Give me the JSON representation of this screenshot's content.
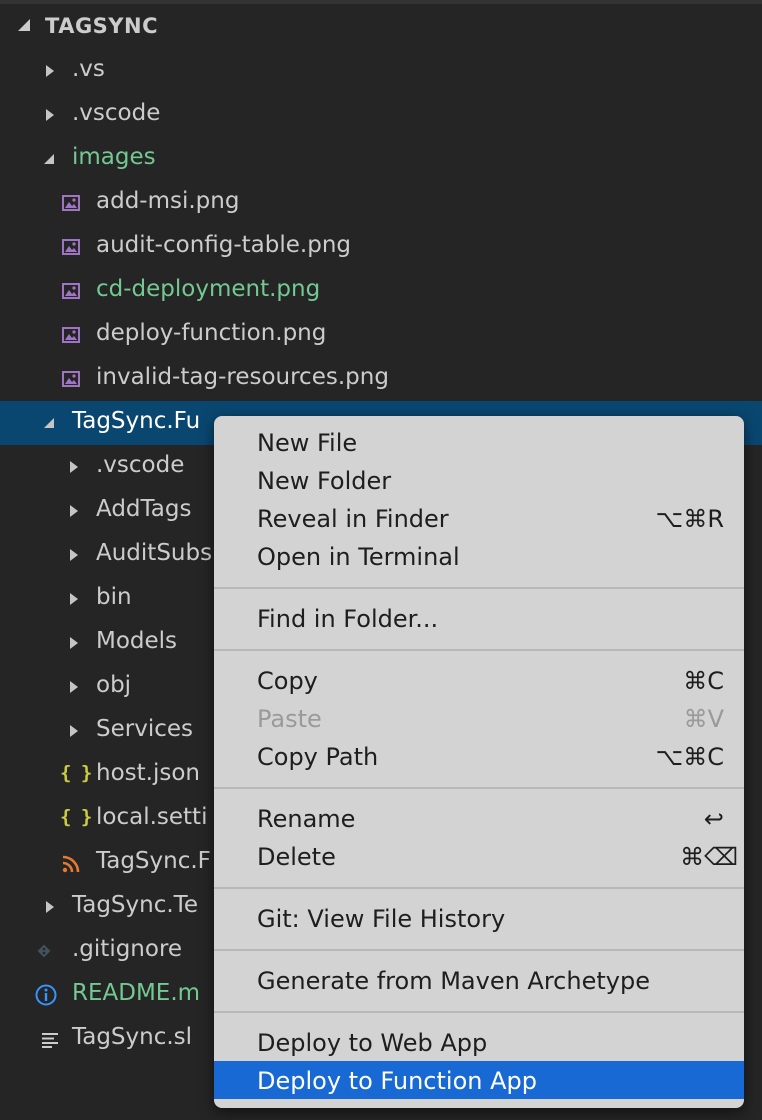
{
  "explorer": {
    "section_title": "TAGSYNC",
    "items": [
      {
        "label": ".vs"
      },
      {
        "label": ".vscode"
      },
      {
        "label": "images"
      },
      {
        "label": "add-msi.png"
      },
      {
        "label": "audit-config-table.png"
      },
      {
        "label": "cd-deployment.png"
      },
      {
        "label": "deploy-function.png"
      },
      {
        "label": "invalid-tag-resources.png"
      },
      {
        "label": "TagSync.Fu"
      },
      {
        "label": ".vscode"
      },
      {
        "label": "AddTags"
      },
      {
        "label": "AuditSubs"
      },
      {
        "label": "bin"
      },
      {
        "label": "Models"
      },
      {
        "label": "obj"
      },
      {
        "label": "Services"
      },
      {
        "label": "host.json"
      },
      {
        "label": "local.setti"
      },
      {
        "label": "TagSync.F"
      },
      {
        "label": "TagSync.Te"
      },
      {
        "label": ".gitignore"
      },
      {
        "label": "README.m"
      },
      {
        "label": "TagSync.sl"
      }
    ],
    "json_icon_glyph": "{ }"
  },
  "context_menu": {
    "items": [
      {
        "label": "New File",
        "shortcut": ""
      },
      {
        "label": "New Folder",
        "shortcut": ""
      },
      {
        "label": "Reveal in Finder",
        "shortcut": "⌥⌘R"
      },
      {
        "label": "Open in Terminal",
        "shortcut": ""
      },
      {
        "label": "Find in Folder...",
        "shortcut": ""
      },
      {
        "label": "Copy",
        "shortcut": "⌘C"
      },
      {
        "label": "Paste",
        "shortcut": "⌘V"
      },
      {
        "label": "Copy Path",
        "shortcut": "⌥⌘C"
      },
      {
        "label": "Rename",
        "shortcut": "↩"
      },
      {
        "label": "Delete",
        "shortcut": "⌘⌫"
      },
      {
        "label": "Git: View File History",
        "shortcut": ""
      },
      {
        "label": "Generate from Maven Archetype",
        "shortcut": ""
      },
      {
        "label": "Deploy to Web App",
        "shortcut": ""
      },
      {
        "label": "Deploy to Function App",
        "shortcut": ""
      }
    ]
  },
  "colors": {
    "sidebar_bg": "#252526",
    "selection_bg": "#094771",
    "git_added_text": "#73c991",
    "menu_bg": "#d3d3d3",
    "menu_highlight": "#1869d3",
    "image_icon": "#a074c4",
    "json_icon": "#cbcb41",
    "rss_icon": "#e37933",
    "info_icon": "#3794ff"
  }
}
